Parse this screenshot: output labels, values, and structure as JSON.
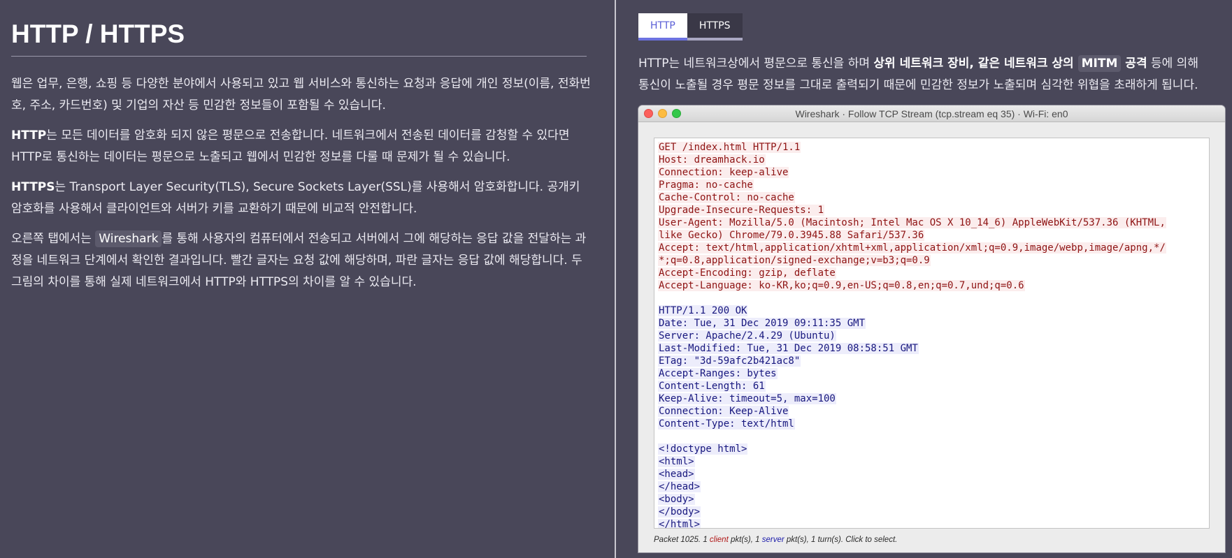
{
  "left": {
    "title": "HTTP / HTTPS",
    "p1": "웹은 업무, 은행, 쇼핑 등 다양한 분야에서 사용되고 있고 웹 서비스와 통신하는 요청과 응답에 개인 정보(이름, 전화번호, 주소, 카드번호) 및 기업의 자산 등 민감한 정보들이 포함될 수 있습니다.",
    "p2_bold": "HTTP",
    "p2": "는 모든 데이터를 암호화 되지 않은 평문으로 전송합니다. 네트워크에서 전송된 데이터를 감청할 수 있다면 HTTP로 통신하는 데이터는 평문으로 노출되고 웹에서 민감한 정보를 다룰 때 문제가 될 수 있습니다.",
    "p3_bold": "HTTPS",
    "p3": "는 Transport Layer Security(TLS), Secure Sockets Layer(SSL)를 사용해서 암호화합니다. 공개키 암호화를 사용해서 클라이언트와 서버가 키를 교환하기 때문에 비교적 안전합니다.",
    "p4_pre": "오른쪽 탭에서는 ",
    "p4_chip": "Wireshark",
    "p4_post": "를 통해 사용자의 컴퓨터에서 전송되고 서버에서 그에 해당하는 응답 값을 전달하는 과정을 네트워크 단계에서 확인한 결과입니다. 빨간 글자는 요청 값에 해당하며, 파란 글자는 응답 값에 해당합니다. 두 그림의 차이를 통해 실제 네트워크에서 HTTP와 HTTPS의 차이를 알 수 있습니다."
  },
  "right": {
    "tabs": [
      {
        "label": "HTTP",
        "active": true
      },
      {
        "label": "HTTPS",
        "active": false
      }
    ],
    "desc_line1_pre": "HTTP는 네트워크상에서 평문으로 통신을 하며 ",
    "desc_line1_bold": "상위 네트워크 장비, 같은 네트워크 상의 ",
    "desc_line1_chip": "MITM",
    "desc_line1_bold2": " 공격",
    "desc_line1_post": " 등에 의해",
    "desc_line2": "통신이 노출될 경우 평문 정보를 그대로 출력되기 때문에 민감한 정보가 노출되며 심각한 위협을 초래하게 됩니다."
  },
  "wireshark": {
    "title": "Wireshark · Follow TCP Stream (tcp.stream eq 35) · Wi-Fi: en0",
    "request": [
      "GET /index.html HTTP/1.1",
      "Host: dreamhack.io",
      "Connection: keep-alive",
      "Pragma: no-cache",
      "Cache-Control: no-cache",
      "Upgrade-Insecure-Requests: 1",
      "User-Agent: Mozilla/5.0 (Macintosh; Intel Mac OS X 10_14_6) AppleWebKit/537.36 (KHTML,",
      "like Gecko) Chrome/79.0.3945.88 Safari/537.36",
      "Accept: text/html,application/xhtml+xml,application/xml;q=0.9,image/webp,image/apng,*/",
      "*;q=0.8,application/signed-exchange;v=b3;q=0.9",
      "Accept-Encoding: gzip, deflate",
      "Accept-Language: ko-KR,ko;q=0.9,en-US;q=0.8,en;q=0.7,und;q=0.6"
    ],
    "response_headers": [
      "HTTP/1.1 200 OK",
      "Date: Tue, 31 Dec 2019 09:11:35 GMT",
      "Server: Apache/2.4.29 (Ubuntu)",
      "Last-Modified: Tue, 31 Dec 2019 08:58:51 GMT",
      "ETag: \"3d-59afc2b421ac8\"",
      "Accept-Ranges: bytes",
      "Content-Length: 61",
      "Keep-Alive: timeout=5, max=100",
      "Connection: Keep-Alive",
      "Content-Type: text/html"
    ],
    "response_body": [
      "<!doctype html>",
      "<html>",
      "<head>",
      "</head>",
      "<body>",
      "</body>",
      "</html>"
    ],
    "status_pre": "Packet 1025. 1 ",
    "status_client": "client",
    "status_mid": " pkt(s), 1 ",
    "status_server": "server",
    "status_post": " pkt(s), 1 turn(s). Click to select.",
    "colors": {
      "client_text": "#8e1313",
      "client_bg": "#fbeded",
      "server_text": "#17177e",
      "server_bg": "#ededfb"
    }
  }
}
